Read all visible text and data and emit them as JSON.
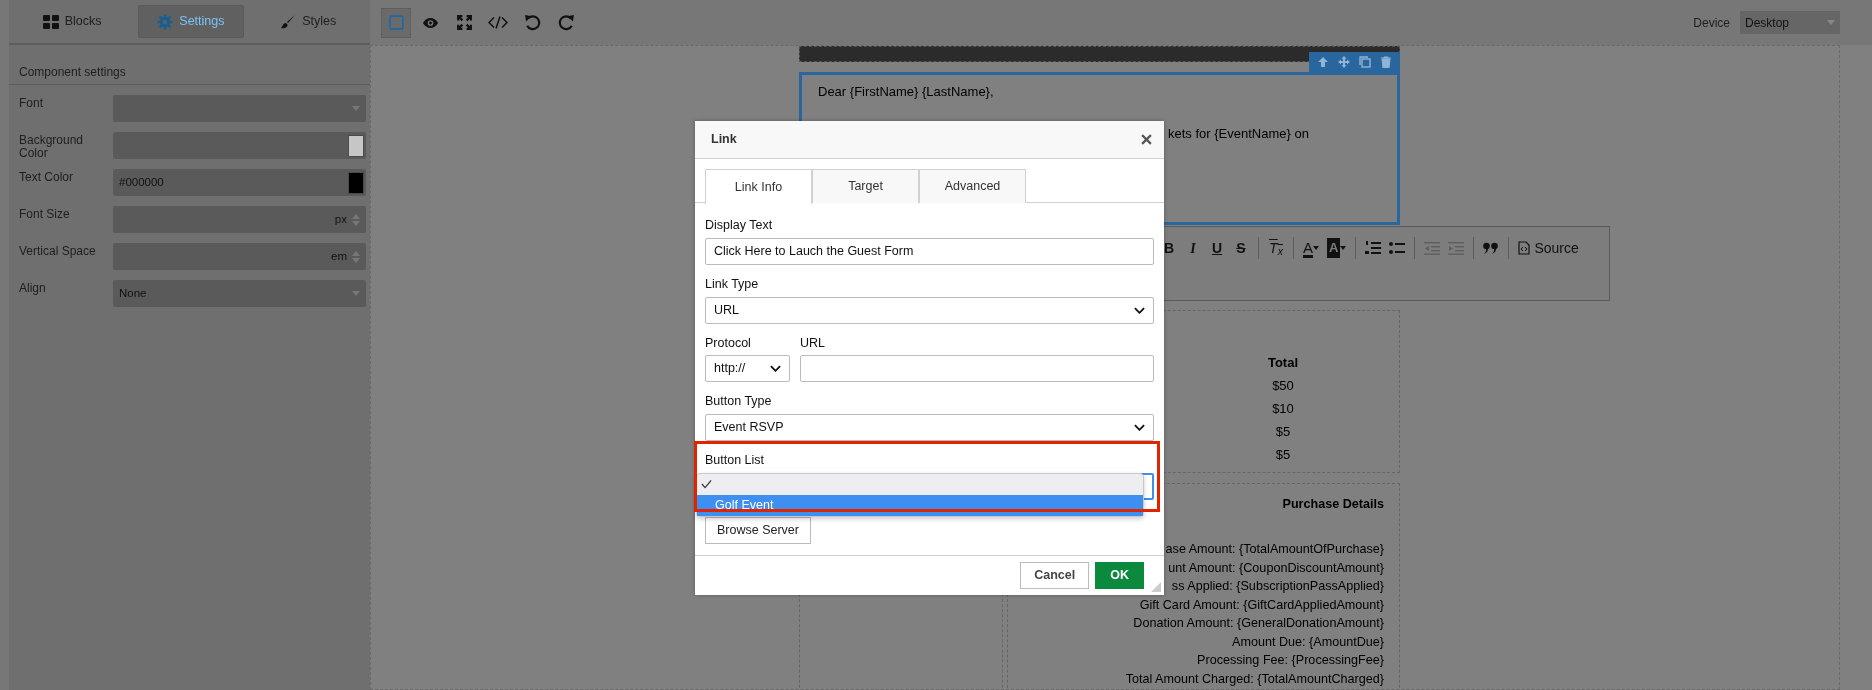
{
  "sidebar": {
    "tabs": [
      {
        "label": "Blocks",
        "selected": false
      },
      {
        "label": "Settings",
        "selected": true
      },
      {
        "label": "Styles",
        "selected": false
      }
    ],
    "heading": "Component settings",
    "fields": [
      {
        "label": "Font",
        "kind": "select"
      },
      {
        "label": "Background Color",
        "kind": "color"
      },
      {
        "label": "Text Color",
        "kind": "color",
        "value": "#000000"
      },
      {
        "label": "Font Size",
        "kind": "number",
        "unit": "px"
      },
      {
        "label": "Vertical Space",
        "kind": "number",
        "unit": "em"
      },
      {
        "label": "Align",
        "kind": "select",
        "value": "None"
      }
    ]
  },
  "toolbar": {
    "tools": [
      {
        "selected": true
      },
      {
        "selected": false
      },
      {
        "selected": false
      },
      {
        "selected": false
      },
      {
        "selected": false
      },
      {
        "selected": false
      }
    ],
    "device": {
      "label": "Device",
      "value": "Desktop"
    }
  },
  "email": {
    "greeting": "Dear {FirstName} {LastName},",
    "line_fragment": "kets for {EventName} on",
    "editor_toolbar": [
      {
        "kind": "bold",
        "label": "B"
      },
      {
        "kind": "italic",
        "label": "I"
      },
      {
        "kind": "underline",
        "label": "U"
      },
      {
        "kind": "strike",
        "label": "S"
      },
      {
        "kind": "sep"
      },
      {
        "kind": "clear",
        "label": "T$_{x}$"
      },
      {
        "kind": "sep"
      },
      {
        "kind": "text-color",
        "label": "A"
      },
      {
        "kind": "bg-color",
        "label": "A"
      },
      {
        "kind": "sep"
      },
      {
        "kind": "ol"
      },
      {
        "kind": "ul"
      },
      {
        "kind": "sep"
      },
      {
        "kind": "outdent"
      },
      {
        "kind": "indent"
      },
      {
        "kind": "sep"
      },
      {
        "kind": "quote"
      },
      {
        "kind": "sep"
      },
      {
        "kind": "source",
        "label": "Source"
      }
    ],
    "totals": {
      "header": "Total",
      "values": [
        "$50",
        "$10",
        "$5",
        "$5"
      ]
    },
    "purchase_details": {
      "title": "Purchase Details",
      "lines": [
        "ase Amount: {TotalAmountOfPurchase}",
        "unt Amount: {CouponDiscountAmount}",
        "ss Applied: {SubscriptionPassApplied}",
        "Gift Card Amount: {GiftCardAppliedAmount}",
        "Donation Amount: {GeneralDonationAmount}",
        "Amount Due: {AmountDue}",
        "Processing Fee: {ProcessingFee}",
        "Total Amount Charged: {TotalAmountCharged}"
      ]
    }
  },
  "dialog": {
    "title": "Link",
    "tabs": [
      {
        "label": "Link Info",
        "selected": true
      },
      {
        "label": "Target",
        "selected": false
      },
      {
        "label": "Advanced",
        "selected": false
      }
    ],
    "display_text": {
      "label": "Display Text",
      "value": "Click Here to Lauch the Guest Form"
    },
    "link_type": {
      "label": "Link Type",
      "value": "URL"
    },
    "protocol": {
      "label": "Protocol",
      "value": "http://"
    },
    "url": {
      "label": "URL"
    },
    "button_type": {
      "label": "Button Type",
      "value": "Event RSVP"
    },
    "button_list": {
      "label": "Button List",
      "focused": true,
      "menu": {
        "blank_selected": true,
        "options": [
          {
            "label": "Golf Event",
            "highlighted": true
          }
        ]
      }
    },
    "browse_button": "Browse Server",
    "buttons": [
      {
        "label": "Cancel",
        "kind": "secondary"
      },
      {
        "label": "OK",
        "kind": "primary"
      }
    ]
  }
}
